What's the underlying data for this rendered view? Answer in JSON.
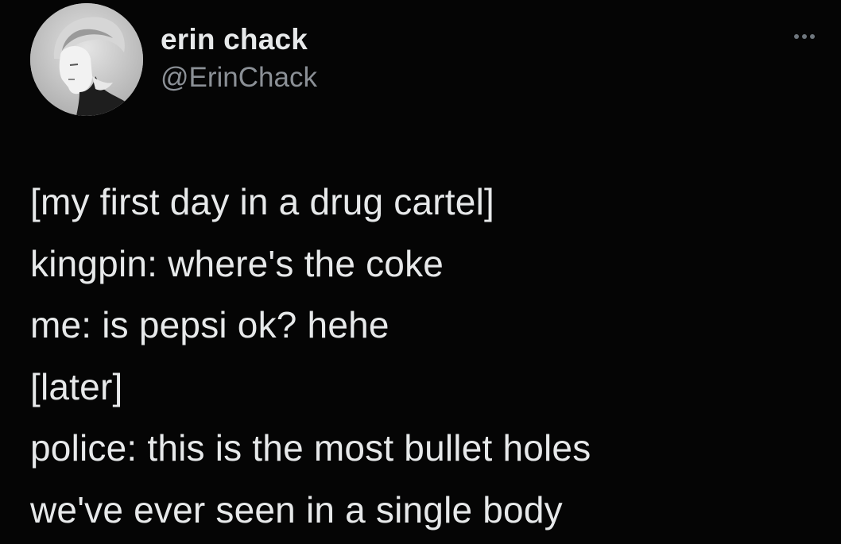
{
  "tweet": {
    "author": {
      "display_name": "erin chack",
      "handle": "@ErinChack",
      "avatar_icon": "user-avatar-photo"
    },
    "more_icon": "ellipsis-icon",
    "text_lines": [
      "[my first day in a drug cartel]",
      "kingpin: where's the coke",
      "me: is pepsi ok? hehe",
      "[later]",
      "police: this is the most bullet holes",
      "we've ever seen in a single body"
    ]
  },
  "colors": {
    "background": "#050505",
    "primary_text": "#e7e9ea",
    "secondary_text": "#8b9096"
  }
}
